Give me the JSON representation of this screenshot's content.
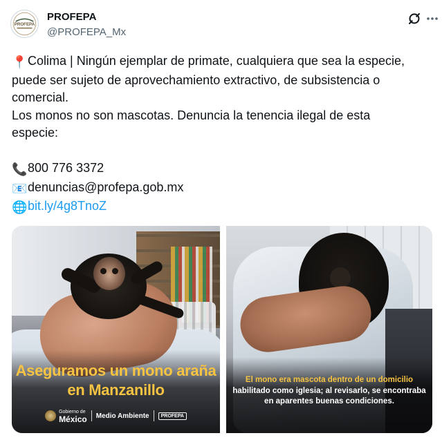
{
  "post": {
    "author": {
      "name": "PROFEPA",
      "handle": "@PROFEPA_Mx",
      "avatar_text": "PROFEPA"
    },
    "icons": {
      "grok": "grok-icon",
      "more": "more-icon"
    },
    "text": {
      "line1": "Colima | Ningún ejemplar de primate, cualquiera que sea la especie,",
      "line2": "puede ser sujeto de aprovechamiento extractivo, de subsistencia o",
      "line3": "comercial.",
      "line4": "Los monos no son mascotas. Denuncia la tenencia ilegal de esta",
      "line5": "especie:",
      "pin_emoji": "📍",
      "phone_emoji": "📞",
      "phone": "800 776 3372",
      "email_emoji": "📧",
      "email": "denuncias@profepa.gob.mx",
      "globe_emoji": "🌐",
      "link": "bit.ly/4g8TnoZ"
    },
    "media": {
      "left": {
        "caption_line1": "Aseguramos un mono araña",
        "caption_line2": "en Manzanillo",
        "logo_gob_top": "Gobierno de",
        "logo_gob_bottom": "México",
        "logo_ma": "Medio Ambiente",
        "logo_pf": "PROFEPA"
      },
      "right": {
        "caption_line1": "El mono era mascota dentro de un domicilio",
        "caption_line2": "habilitado como iglesia; al revisarlo, se encontraba",
        "caption_line3": "en aparentes buenas condiciones."
      }
    },
    "colors": {
      "text": "#0f1419",
      "secondary": "#536471",
      "link": "#1d9bf0",
      "caption_yellow": "#f6c342"
    }
  }
}
